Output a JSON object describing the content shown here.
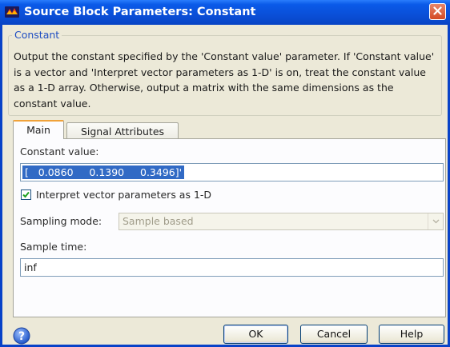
{
  "window": {
    "title": "Source Block Parameters: Constant"
  },
  "group": {
    "legend": "Constant",
    "description": "Output the constant specified by the 'Constant value' parameter. If 'Constant value' is a vector and 'Interpret vector parameters as 1-D' is on, treat the constant value as a 1-D array. Otherwise, output a matrix with the same dimensions as the constant value."
  },
  "tabs": [
    {
      "label": "Main",
      "active": true
    },
    {
      "label": "Signal Attributes",
      "active": false
    }
  ],
  "main": {
    "constant_value_label": "Constant value:",
    "constant_value": "[   0.0860     0.1390     0.3496]'",
    "interpret_label": "Interpret vector parameters as 1-D",
    "interpret_checked": true,
    "sampling_mode_label": "Sampling mode:",
    "sampling_mode_value": "Sample based",
    "sample_time_label": "Sample time:",
    "sample_time_value": "inf"
  },
  "buttons": {
    "ok": "OK",
    "cancel": "Cancel",
    "help": "Help"
  },
  "colors": {
    "titlebar": "#0a4fd8",
    "legend_text": "#1f4ec2",
    "selection": "#316ac5",
    "dialog_bg": "#ece9d8"
  },
  "icons": {
    "app": "simulink-block-icon",
    "close": "close-icon",
    "help": "help-question-icon",
    "dropdown": "chevron-down-icon",
    "check": "checkmark-icon"
  }
}
